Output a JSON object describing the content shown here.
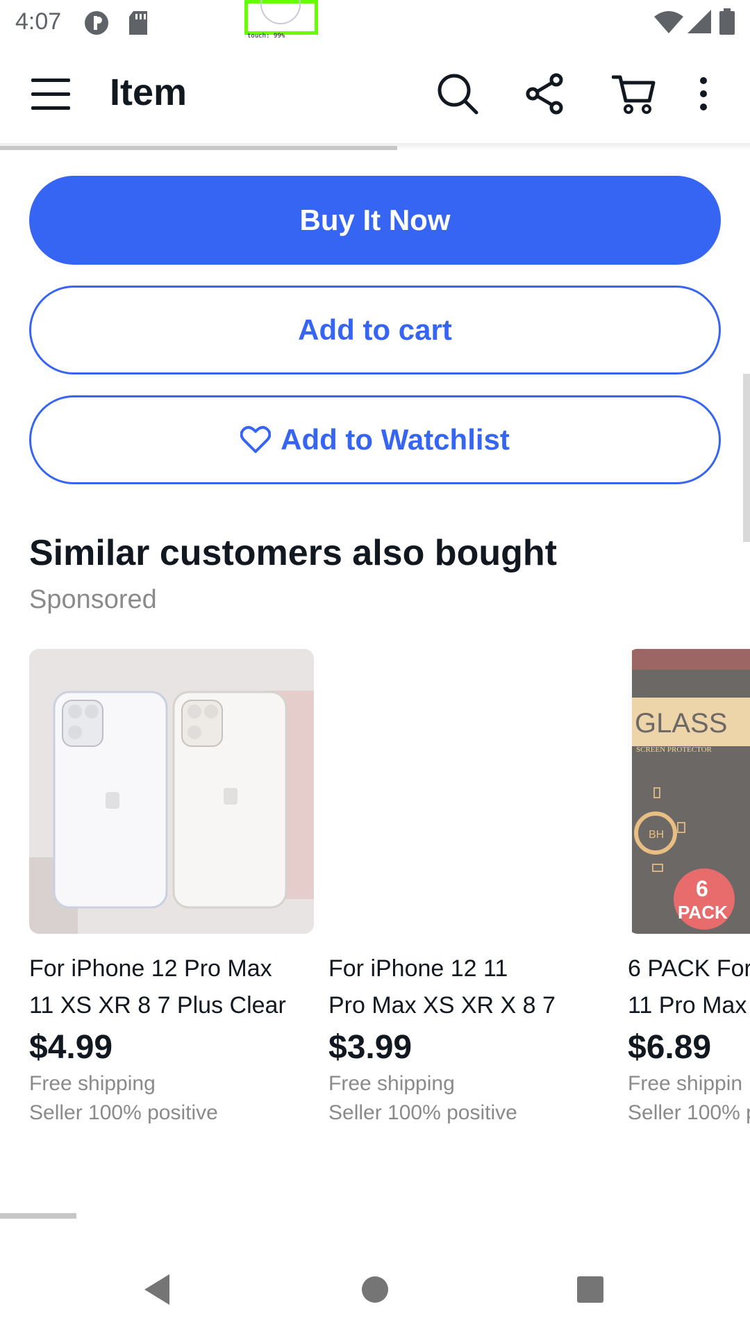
{
  "status_bar": {
    "time": "4:07",
    "touch_overlay": "touch: 99%"
  },
  "app_bar": {
    "title": "Item",
    "menu_icon": "hamburger-menu-icon",
    "search_icon": "search-icon",
    "share_icon": "share-icon",
    "cart_icon": "cart-icon",
    "more_icon": "more-vertical-icon"
  },
  "actions": {
    "buy_now": "Buy It Now",
    "add_to_cart": "Add to cart",
    "add_to_watchlist": "Add to Watchlist"
  },
  "colors": {
    "accent": "#3665f3",
    "text": "#111820",
    "muted": "#8a8a8a"
  },
  "similar": {
    "title": "Similar customers also bought",
    "subtitle": "Sponsored",
    "items": [
      {
        "title_line1": "For iPhone 12 Pro Max",
        "title_line2": "11 XS XR 8 7 Plus Clear",
        "price": "$4.99",
        "shipping": "Free shipping",
        "seller": "Seller 100% positive"
      },
      {
        "title_line1": "For iPhone 12 11",
        "title_line2": "Pro Max XS XR X 8 7",
        "price": "$3.99",
        "shipping": "Free shipping",
        "seller": "Seller 100% positive"
      },
      {
        "title_line1": "6 PACK For",
        "title_line2": "11 Pro Max",
        "price": "$6.89",
        "shipping": "Free shippin",
        "seller": "Seller 100% p",
        "image_text_1": "GLASS",
        "image_text_2": "SCREEN PROTECTOR",
        "image_text_3": "BH",
        "badge_line1": "6",
        "badge_line2": "PACK"
      }
    ]
  },
  "nav_bar": {
    "back_icon": "back-triangle-icon",
    "home_icon": "home-circle-icon",
    "recents_icon": "recents-square-icon"
  }
}
